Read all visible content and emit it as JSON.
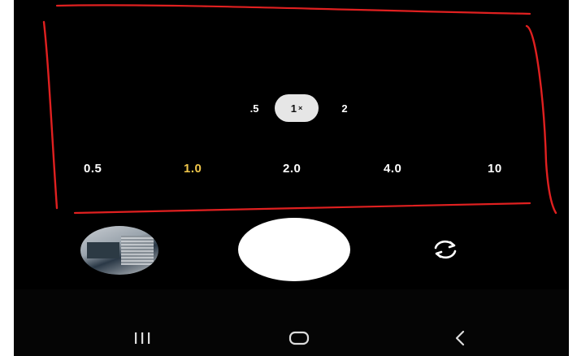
{
  "zoom_pills": {
    "wide": ".5",
    "normal": "1",
    "normal_suffix": "×",
    "tele": "2"
  },
  "zoom_scale": [
    "0.5",
    "1.0",
    "2.0",
    "4.0",
    "10"
  ],
  "selected_zoom": "1.0",
  "colors": {
    "background": "#000000",
    "selected_zoom": "#f0c64a",
    "annotation": "#e02020",
    "shutter": "#ffffff"
  },
  "icons": {
    "gallery": "gallery-thumbnail",
    "switch_camera": "switch-camera-icon",
    "recent_apps": "recent-apps-icon",
    "home": "home-icon",
    "back": "back-icon"
  }
}
